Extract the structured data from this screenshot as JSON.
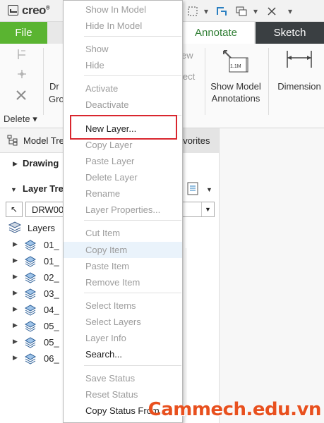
{
  "app": {
    "name": "creo",
    "trademark": "®"
  },
  "tabs": {
    "file": "File",
    "annotate": "Annotate",
    "sketch": "Sketch"
  },
  "ribbon": {
    "items": [
      "Dr",
      "Gro",
      "ew",
      "ject"
    ],
    "show_model_annotations": "Show Model\nAnnotations",
    "dimension": "Dimension",
    "delete_group": "Delete",
    "scale_badge": "1.1M"
  },
  "panel": {
    "model_tree_tab": "Model Tre",
    "favorites_tab": "avorites",
    "drawing_row": "Drawing",
    "layer_tree_row": "Layer Tre",
    "drawing_combo": "DRW00",
    "layers_root": "Layers",
    "layers": [
      "01_",
      "01_",
      "02_",
      "03_",
      "04_",
      "05_",
      "05_",
      "06_"
    ]
  },
  "menu": {
    "items": [
      {
        "label": "Show In Model",
        "enabled": false
      },
      {
        "label": "Hide In Model",
        "enabled": false
      },
      {
        "label": "Show",
        "enabled": false
      },
      {
        "label": "Hide",
        "enabled": false
      },
      {
        "label": "Activate",
        "enabled": false
      },
      {
        "label": "Deactivate",
        "enabled": false
      },
      {
        "label": "New Layer...",
        "enabled": true
      },
      {
        "label": "Copy Layer",
        "enabled": false
      },
      {
        "label": "Paste Layer",
        "enabled": false
      },
      {
        "label": "Delete Layer",
        "enabled": false
      },
      {
        "label": "Rename",
        "enabled": false
      },
      {
        "label": "Layer Properties...",
        "enabled": false
      },
      {
        "label": "Cut Item",
        "enabled": false
      },
      {
        "label": "Copy Item",
        "enabled": false
      },
      {
        "label": "Paste Item",
        "enabled": false
      },
      {
        "label": "Remove Item",
        "enabled": false
      },
      {
        "label": "Select Items",
        "enabled": false
      },
      {
        "label": "Select Layers",
        "enabled": false
      },
      {
        "label": "Layer Info",
        "enabled": false
      },
      {
        "label": "Search...",
        "enabled": true
      },
      {
        "label": "Save Status",
        "enabled": false
      },
      {
        "label": "Reset Status",
        "enabled": false
      },
      {
        "label": "Copy Status From...",
        "enabled": true
      }
    ]
  },
  "watermark": "Cammech.edu.vn",
  "colors": {
    "file_tab": "#5ab431",
    "annotate_text": "#2e7d32",
    "sketch_tab": "#3a3f42",
    "highlight": "#d9262e",
    "watermark": "#e8501e"
  }
}
